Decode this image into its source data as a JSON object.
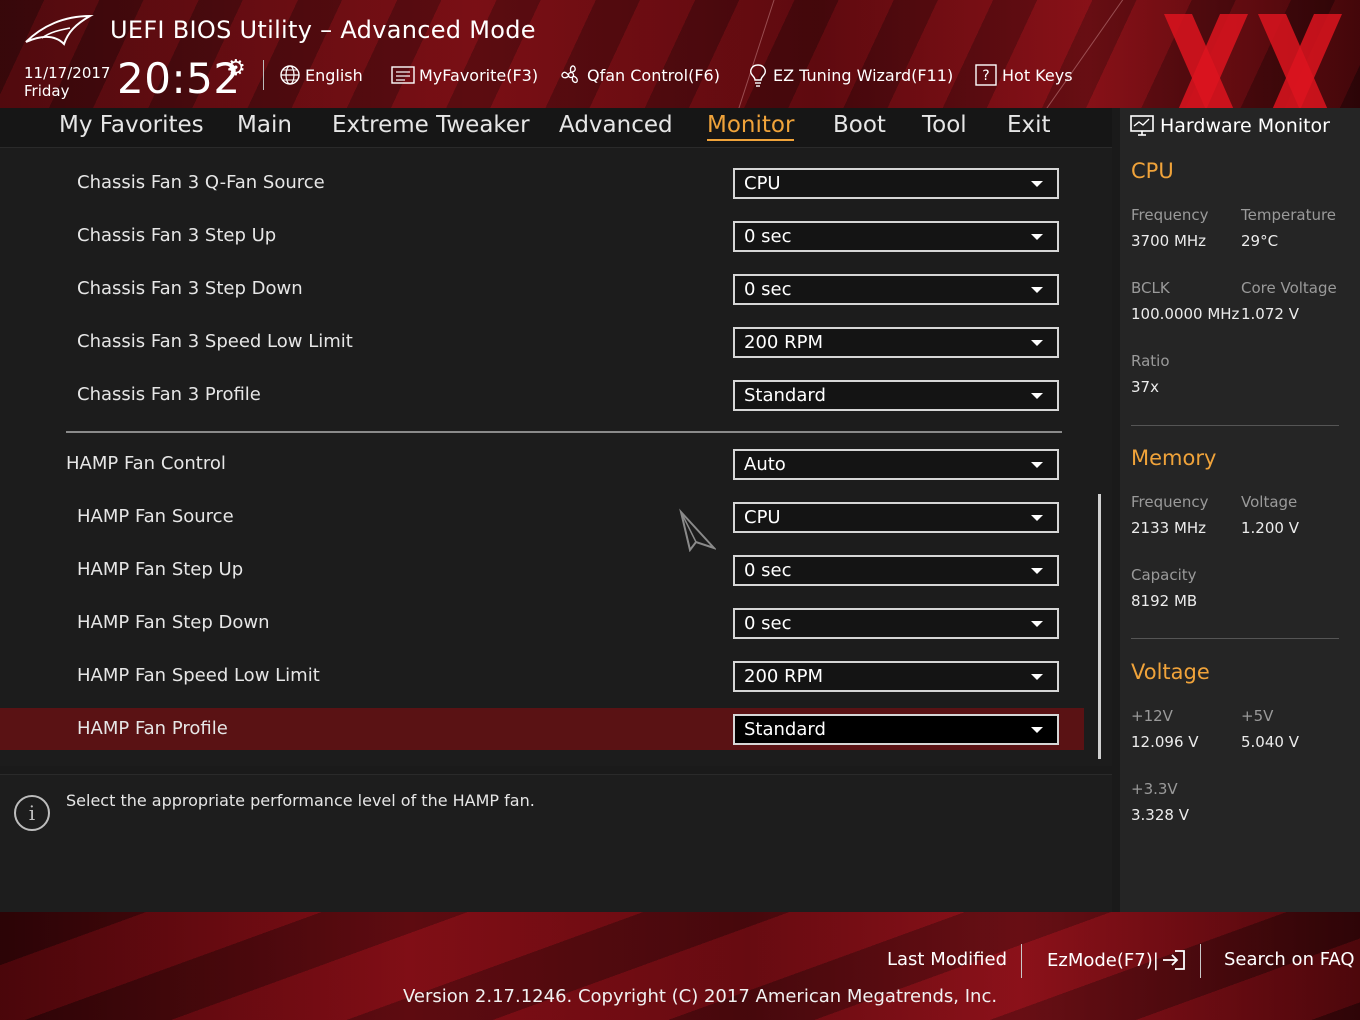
{
  "header": {
    "title": "UEFI BIOS Utility – Advanced Mode",
    "date": "11/17/2017",
    "day": "Friday",
    "time": "20:52",
    "buttons": {
      "language": "English",
      "myfavorite": "MyFavorite(F3)",
      "qfan": "Qfan Control(F6)",
      "ez_tuning": "EZ Tuning Wizard(F11)",
      "hotkeys": "Hot Keys"
    }
  },
  "nav": {
    "tabs": [
      "My Favorites",
      "Main",
      "Extreme Tweaker",
      "Advanced",
      "Monitor",
      "Boot",
      "Tool",
      "Exit"
    ],
    "active": "Monitor"
  },
  "settings": [
    {
      "label": "Chassis Fan 3 Q-Fan Source",
      "value": "CPU"
    },
    {
      "label": "Chassis Fan 3 Step Up",
      "value": "0 sec"
    },
    {
      "label": "Chassis Fan 3 Step Down",
      "value": "0 sec"
    },
    {
      "label": "Chassis Fan 3 Speed Low Limit",
      "value": "200 RPM"
    },
    {
      "label": "Chassis Fan 3 Profile",
      "value": "Standard"
    },
    {
      "label": "HAMP Fan Control",
      "value": "Auto"
    },
    {
      "label": "HAMP Fan Source",
      "value": "CPU"
    },
    {
      "label": "HAMP Fan Step Up",
      "value": "0 sec"
    },
    {
      "label": "HAMP Fan Step Down",
      "value": "0 sec"
    },
    {
      "label": "HAMP Fan Speed Low Limit",
      "value": "200 RPM"
    },
    {
      "label": "HAMP Fan Profile",
      "value": "Standard"
    }
  ],
  "info": {
    "text": "Select the appropriate performance level of the HAMP fan."
  },
  "hardware_monitor": {
    "title": "Hardware Monitor",
    "cpu": {
      "heading": "CPU",
      "frequency_label": "Frequency",
      "frequency": "3700 MHz",
      "temperature_label": "Temperature",
      "temperature": "29°C",
      "bclk_label": "BCLK",
      "bclk": "100.0000 MHz",
      "core_voltage_label": "Core Voltage",
      "core_voltage": "1.072 V",
      "ratio_label": "Ratio",
      "ratio": "37x"
    },
    "memory": {
      "heading": "Memory",
      "frequency_label": "Frequency",
      "frequency": "2133 MHz",
      "voltage_label": "Voltage",
      "voltage": "1.200 V",
      "capacity_label": "Capacity",
      "capacity": "8192 MB"
    },
    "voltage": {
      "heading": "Voltage",
      "v12_label": "+12V",
      "v12": "12.096 V",
      "v5_label": "+5V",
      "v5": "5.040 V",
      "v33_label": "+3.3V",
      "v33": "3.328 V"
    }
  },
  "footer": {
    "last_modified": "Last Modified",
    "ezmode": "EzMode(F7)|",
    "search_faq": "Search on FAQ",
    "version": "Version 2.17.1246. Copyright (C) 2017 American Megatrends, Inc."
  },
  "colors": {
    "accent": "#f0a33a",
    "selected_row": "#5a1214",
    "brand_red": "#7a1016"
  }
}
